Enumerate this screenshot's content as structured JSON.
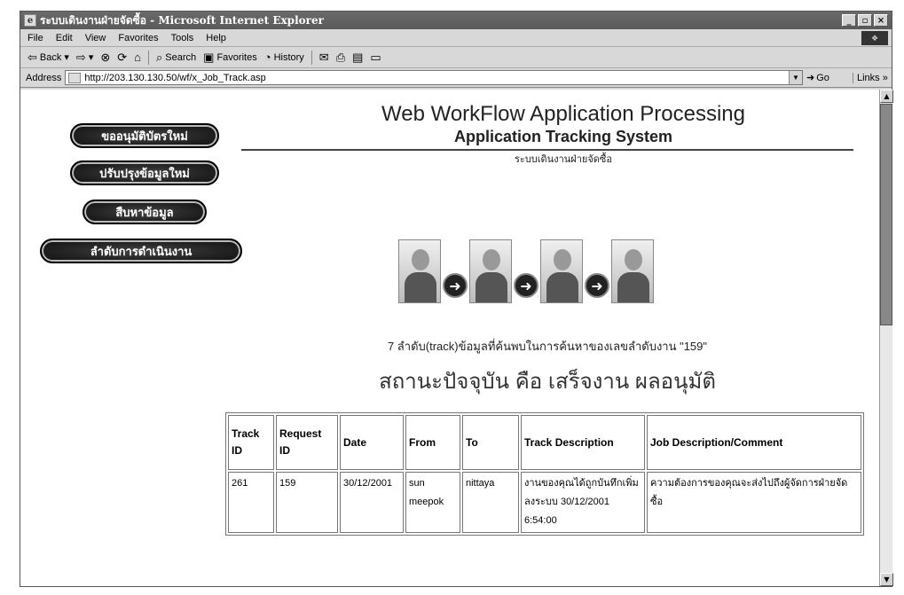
{
  "window": {
    "title": "ระบบเดินงานฝ่ายจัดซื้อ - Microsoft Internet Explorer",
    "controls": [
      "_",
      "▫",
      "×"
    ]
  },
  "menu": [
    "File",
    "Edit",
    "View",
    "Favorites",
    "Tools",
    "Help"
  ],
  "toolbar": {
    "back": "Back",
    "search": "Search",
    "favorites": "Favorites",
    "history": "History"
  },
  "address": {
    "label": "Address",
    "url": "http://203.130.130.50/wf/x_Job_Track.asp",
    "go": "Go",
    "links": "Links »"
  },
  "sidebar": {
    "buttons": [
      "ขออนุมัติบัตรใหม่",
      "ปรับปรุงข้อมูลใหม่",
      "สืบหาข้อมูล",
      "ลำดับการดำเนินงาน"
    ]
  },
  "header": {
    "title": "Web WorkFlow Application Processing",
    "subtitle": "Application Tracking System",
    "thai_subtitle": "ระบบเดินงานฝ่ายจัดซื้อ"
  },
  "result": {
    "summary": "7 ลำดับ(track)ข้อมูลที่ค้นพบในการค้นหาของเลขลำดับงาน \"159\"",
    "status": "สถานะปัจจุบัน คือ เสร็จงาน ผลอนุมัติ"
  },
  "table": {
    "headers": [
      "Track ID",
      "Request ID",
      "Date",
      "From",
      "To",
      "Track Description",
      "Job Description/Comment"
    ],
    "rows": [
      {
        "track_id": "261",
        "request_id": "159",
        "date": "30/12/2001",
        "from": "sun meepok",
        "to": "nittaya",
        "track_desc": "งานของคุณได้ถูกบันทึกเพิ่มลงระบบ 30/12/2001 6:54:00",
        "job_desc": "ความต้องการของคุณจะส่งไปถึงผู้จัดการฝ่ายจัดซื้อ"
      }
    ]
  }
}
